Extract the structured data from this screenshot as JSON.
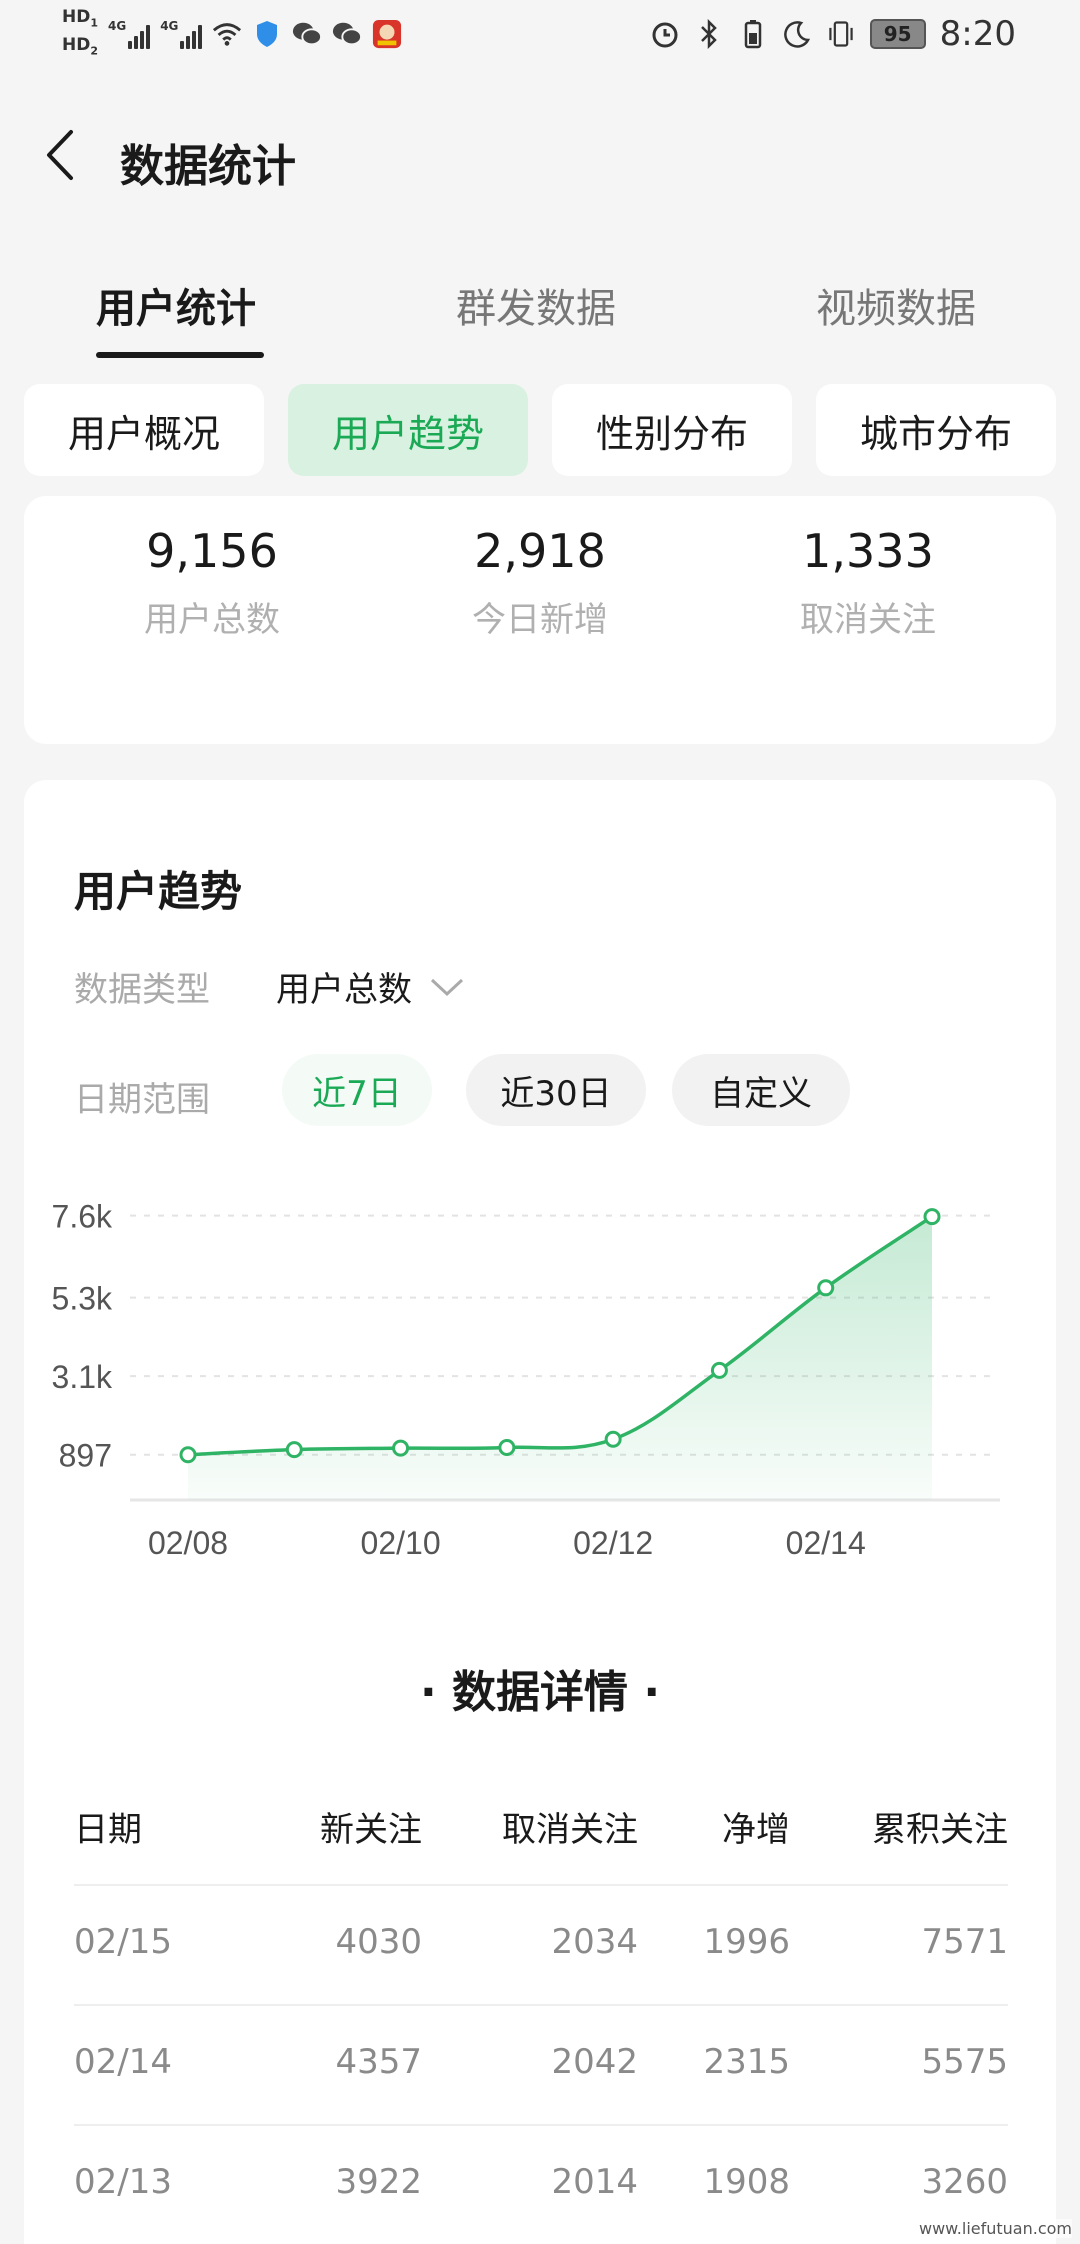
{
  "status_bar": {
    "hd1": "HD",
    "hd1_sub": "1",
    "hd2": "HD",
    "hd2_sub": "2",
    "net1": "4G",
    "net2": "4G",
    "battery": "95",
    "time": "8:20",
    "icons": [
      "signal-icon",
      "wifi-icon",
      "shield-icon",
      "wechat-icon",
      "wechat-icon",
      "app-icon",
      "alarm-icon",
      "bluetooth-icon",
      "battery-saver-icon",
      "moon-icon",
      "vibrate-icon"
    ]
  },
  "header": {
    "title": "数据统计"
  },
  "main_tabs": [
    {
      "label": "用户统计",
      "active": true
    },
    {
      "label": "群发数据",
      "active": false
    },
    {
      "label": "视频数据",
      "active": false
    }
  ],
  "sub_tabs": [
    {
      "label": "用户概况",
      "active": false
    },
    {
      "label": "用户趋势",
      "active": true
    },
    {
      "label": "性别分布",
      "active": false
    },
    {
      "label": "城市分布",
      "active": false
    }
  ],
  "stats": [
    {
      "value": "9,156",
      "label": "用户总数"
    },
    {
      "value": "2,918",
      "label": "今日新增"
    },
    {
      "value": "1,333",
      "label": "取消关注"
    }
  ],
  "trend": {
    "title": "用户趋势",
    "data_type_label": "数据类型",
    "data_type_value": "用户总数",
    "date_range_label": "日期范围",
    "ranges": [
      {
        "label": "近7日",
        "active": true
      },
      {
        "label": "近30日",
        "active": false
      },
      {
        "label": "自定义",
        "active": false
      }
    ]
  },
  "chart_data": {
    "type": "area",
    "x": [
      "02/08",
      "02/09",
      "02/10",
      "02/11",
      "02/12",
      "02/13",
      "02/14",
      "02/15"
    ],
    "x_tick_labels": [
      "02/08",
      "02/10",
      "02/12",
      "02/14"
    ],
    "y_tick_labels": [
      "897",
      "3.1k",
      "5.3k",
      "7.6k"
    ],
    "y_ticks": [
      897,
      3100,
      5300,
      7600
    ],
    "series": [
      {
        "values": [
          897,
          1040,
          1080,
          1100,
          1330,
          3260,
          5575,
          7571
        ]
      }
    ],
    "ylim": [
      300,
      7700
    ],
    "grid": true,
    "colors": {
      "line": "#2fb365",
      "fill": "#2fb365",
      "grid": "#e3e3e3"
    }
  },
  "details": {
    "title": "数据详情",
    "columns": [
      "日期",
      "新关注",
      "取消关注",
      "净增",
      "累积关注"
    ],
    "rows": [
      [
        "02/15",
        "4030",
        "2034",
        "1996",
        "7571"
      ],
      [
        "02/14",
        "4357",
        "2042",
        "2315",
        "5575"
      ],
      [
        "02/13",
        "3922",
        "2014",
        "1908",
        "3260"
      ]
    ]
  },
  "watermark": "www.liefutuan.com",
  "colors": {
    "accent": "#1aa955",
    "accent_bg": "#d9f1e0"
  }
}
